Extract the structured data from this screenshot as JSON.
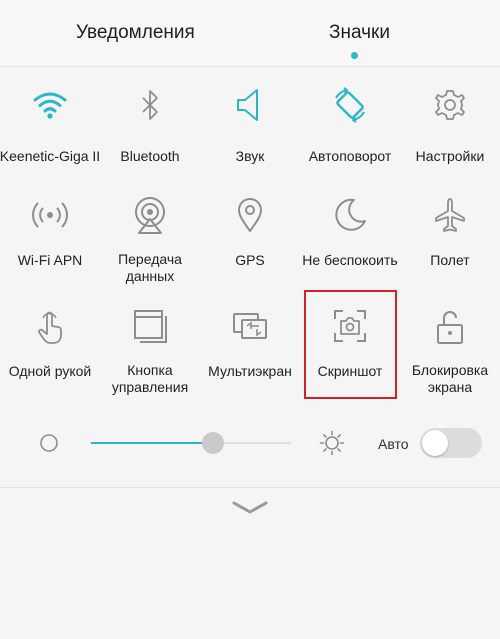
{
  "tabs": {
    "notifications": "Уведомления",
    "icons": "Значки"
  },
  "tiles": [
    {
      "label": "Keenetic-Giga II",
      "icon": "wifi-icon",
      "active": true
    },
    {
      "label": "Bluetooth",
      "icon": "bluetooth-icon",
      "active": false
    },
    {
      "label": "Звук",
      "icon": "sound-icon",
      "active": true
    },
    {
      "label": "Автоповорот",
      "icon": "auto-rotate-icon",
      "active": true
    },
    {
      "label": "Настройки",
      "icon": "gear-icon",
      "active": false
    },
    {
      "label": "Wi-Fi APN",
      "icon": "hotspot-icon",
      "active": false
    },
    {
      "label": "Передача\nданных",
      "icon": "mobile-data-icon",
      "active": false
    },
    {
      "label": "GPS",
      "icon": "location-icon",
      "active": false
    },
    {
      "label": "Не беспокоить",
      "icon": "moon-icon",
      "active": false
    },
    {
      "label": "Полет",
      "icon": "airplane-icon",
      "active": false
    },
    {
      "label": "Одной рукой",
      "icon": "one-hand-icon",
      "active": false
    },
    {
      "label": "Кнопка\nуправления",
      "icon": "nav-button-icon",
      "active": false
    },
    {
      "label": "Мультиэкран",
      "icon": "multiscreen-icon",
      "active": false
    },
    {
      "label": "Скриншот",
      "icon": "screenshot-icon",
      "active": false
    },
    {
      "label": "Блокировка\nэкрана",
      "icon": "lock-icon",
      "active": false
    }
  ],
  "brightness": {
    "level": 0.61,
    "auto_label": "Авто",
    "auto_enabled": false
  },
  "colors": {
    "accent": "#2bb6c9",
    "inactive": "#8e8e8e",
    "highlight": "#d0222d"
  }
}
